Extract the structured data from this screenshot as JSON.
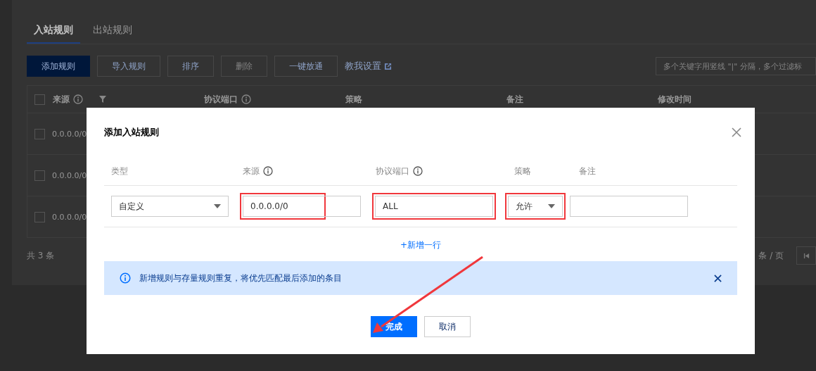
{
  "tabs": [
    {
      "label": "入站规则",
      "selected": true
    },
    {
      "label": "出站规则",
      "selected": false
    }
  ],
  "toolbar": {
    "buttons": [
      {
        "label": "添加规则",
        "kind": "primary",
        "disabled": false
      },
      {
        "label": "导入规则",
        "kind": "default",
        "disabled": false
      },
      {
        "label": "排序",
        "kind": "default",
        "disabled": false
      },
      {
        "label": "删除",
        "kind": "default",
        "disabled": true
      },
      {
        "label": "一键放通",
        "kind": "default",
        "disabled": false
      }
    ],
    "help_link": "教我设置",
    "search": {
      "placeholder": "多个关键字用竖线 \"|\" 分隔，多个过滤标"
    }
  },
  "table": {
    "header_checked": false,
    "columns": [
      {
        "label": "来源",
        "info": true,
        "filter": true
      },
      {
        "label": "协议端口",
        "info": true,
        "filter": false
      },
      {
        "label": "策略",
        "info": false,
        "filter": false
      },
      {
        "label": "备注",
        "info": false,
        "filter": false
      },
      {
        "label": "修改时间",
        "info": false,
        "filter": false
      }
    ],
    "rows": [
      {
        "source": "0.0.0.0/0",
        "checked": false
      },
      {
        "source": "0.0.0.0/0",
        "checked": false
      },
      {
        "source": "0.0.0.0/0",
        "checked": false
      }
    ],
    "total": "共 3 条",
    "page_size_label": "条 / 页"
  },
  "dialog": {
    "title": "添加入站规则",
    "columns": [
      {
        "label": "类型",
        "info": false
      },
      {
        "label": "来源",
        "info": true
      },
      {
        "label": "协议端口",
        "info": true
      },
      {
        "label": "策略",
        "info": false
      },
      {
        "label": "备注",
        "info": false
      }
    ],
    "row": [
      {
        "kind": "select",
        "value": "自定义",
        "highlighted": false
      },
      {
        "kind": "input",
        "value": "0.0.0.0/0",
        "highlighted": true
      },
      {
        "kind": "input",
        "value": "ALL",
        "highlighted": true
      },
      {
        "kind": "select",
        "value": "允许",
        "highlighted": true
      },
      {
        "kind": "input",
        "highlighted": false
      }
    ],
    "add_row": "+新增一行",
    "alert": "新增规则与存量规则重复，将优先匹配最后添加的条目",
    "buttons": [
      {
        "label": "完成",
        "kind": "primary"
      },
      {
        "label": "取消",
        "kind": "default"
      }
    ]
  }
}
